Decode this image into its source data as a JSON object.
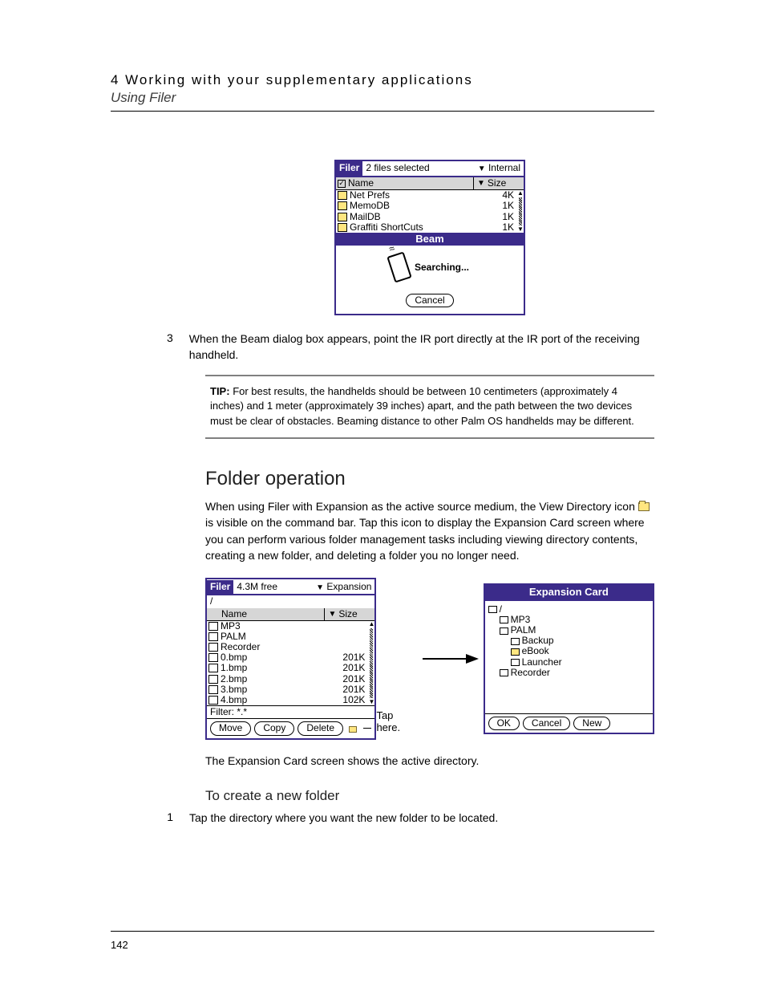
{
  "header": {
    "chapter": "4  Working with your supplementary applications",
    "section": "Using Filer"
  },
  "figure1": {
    "app_label": "Filer",
    "status": "2 files selected",
    "location": "Internal",
    "col_name": "Name",
    "col_size": "Size",
    "files": [
      {
        "name": "Net Prefs",
        "size": "4K"
      },
      {
        "name": "MemoDB",
        "size": "1K"
      },
      {
        "name": "MailDB",
        "size": "1K"
      },
      {
        "name": "Graffiti ShortCuts",
        "size": "1K"
      }
    ],
    "dialog_title": "Beam",
    "dialog_status": "Searching...",
    "cancel": "Cancel"
  },
  "step3": {
    "num": "3",
    "text": "When the Beam dialog box appears, point the IR port directly at the IR port of the receiving handheld."
  },
  "tip": {
    "label": "TIP:",
    "text": "For best results, the handhelds should be between 10 centimeters (approximately 4 inches) and 1 meter (approximately 39 inches) apart, and the path between the two devices must be clear of obstacles. Beaming distance to other Palm OS handhelds may be different."
  },
  "folder_op": {
    "heading": "Folder operation",
    "para_a": "When using Filer with Expansion as the active source medium, the View Directory icon ",
    "para_b": " is visible on the command bar. Tap this icon to display the Expansion Card screen where you can perform various folder management tasks including viewing directory contents, creating a new folder, and deleting a folder you no longer need."
  },
  "figure2": {
    "app_label": "Filer",
    "status": "4.3M free",
    "location": "Expansion",
    "crumb": "/",
    "col_name": "Name",
    "col_size": "Size",
    "files": [
      {
        "name": "MP3",
        "size": ""
      },
      {
        "name": "PALM",
        "size": ""
      },
      {
        "name": "Recorder",
        "size": ""
      },
      {
        "name": "0.bmp",
        "size": "201K"
      },
      {
        "name": "1.bmp",
        "size": "201K"
      },
      {
        "name": "2.bmp",
        "size": "201K"
      },
      {
        "name": "3.bmp",
        "size": "201K"
      },
      {
        "name": "4.bmp",
        "size": "102K"
      }
    ],
    "filter_label": "Filter:",
    "filter_value": "*.*",
    "btn_move": "Move",
    "btn_copy": "Copy",
    "btn_delete": "Delete",
    "tap_here": "Tap here."
  },
  "figure3": {
    "title": "Expansion Card",
    "tree": {
      "root": "/",
      "items": [
        {
          "name": "MP3",
          "indent": 1
        },
        {
          "name": "PALM",
          "indent": 1
        },
        {
          "name": "Backup",
          "indent": 2
        },
        {
          "name": "eBook",
          "indent": 2,
          "open": true
        },
        {
          "name": "Launcher",
          "indent": 2
        },
        {
          "name": "Recorder",
          "indent": 1
        }
      ]
    },
    "btn_ok": "OK",
    "btn_cancel": "Cancel",
    "btn_new": "New"
  },
  "caption": "The Expansion Card screen shows the active directory.",
  "create_folder": {
    "heading": "To create a new folder",
    "step1_num": "1",
    "step1_text": "Tap the directory where you want the new folder to be located."
  },
  "page_number": "142"
}
